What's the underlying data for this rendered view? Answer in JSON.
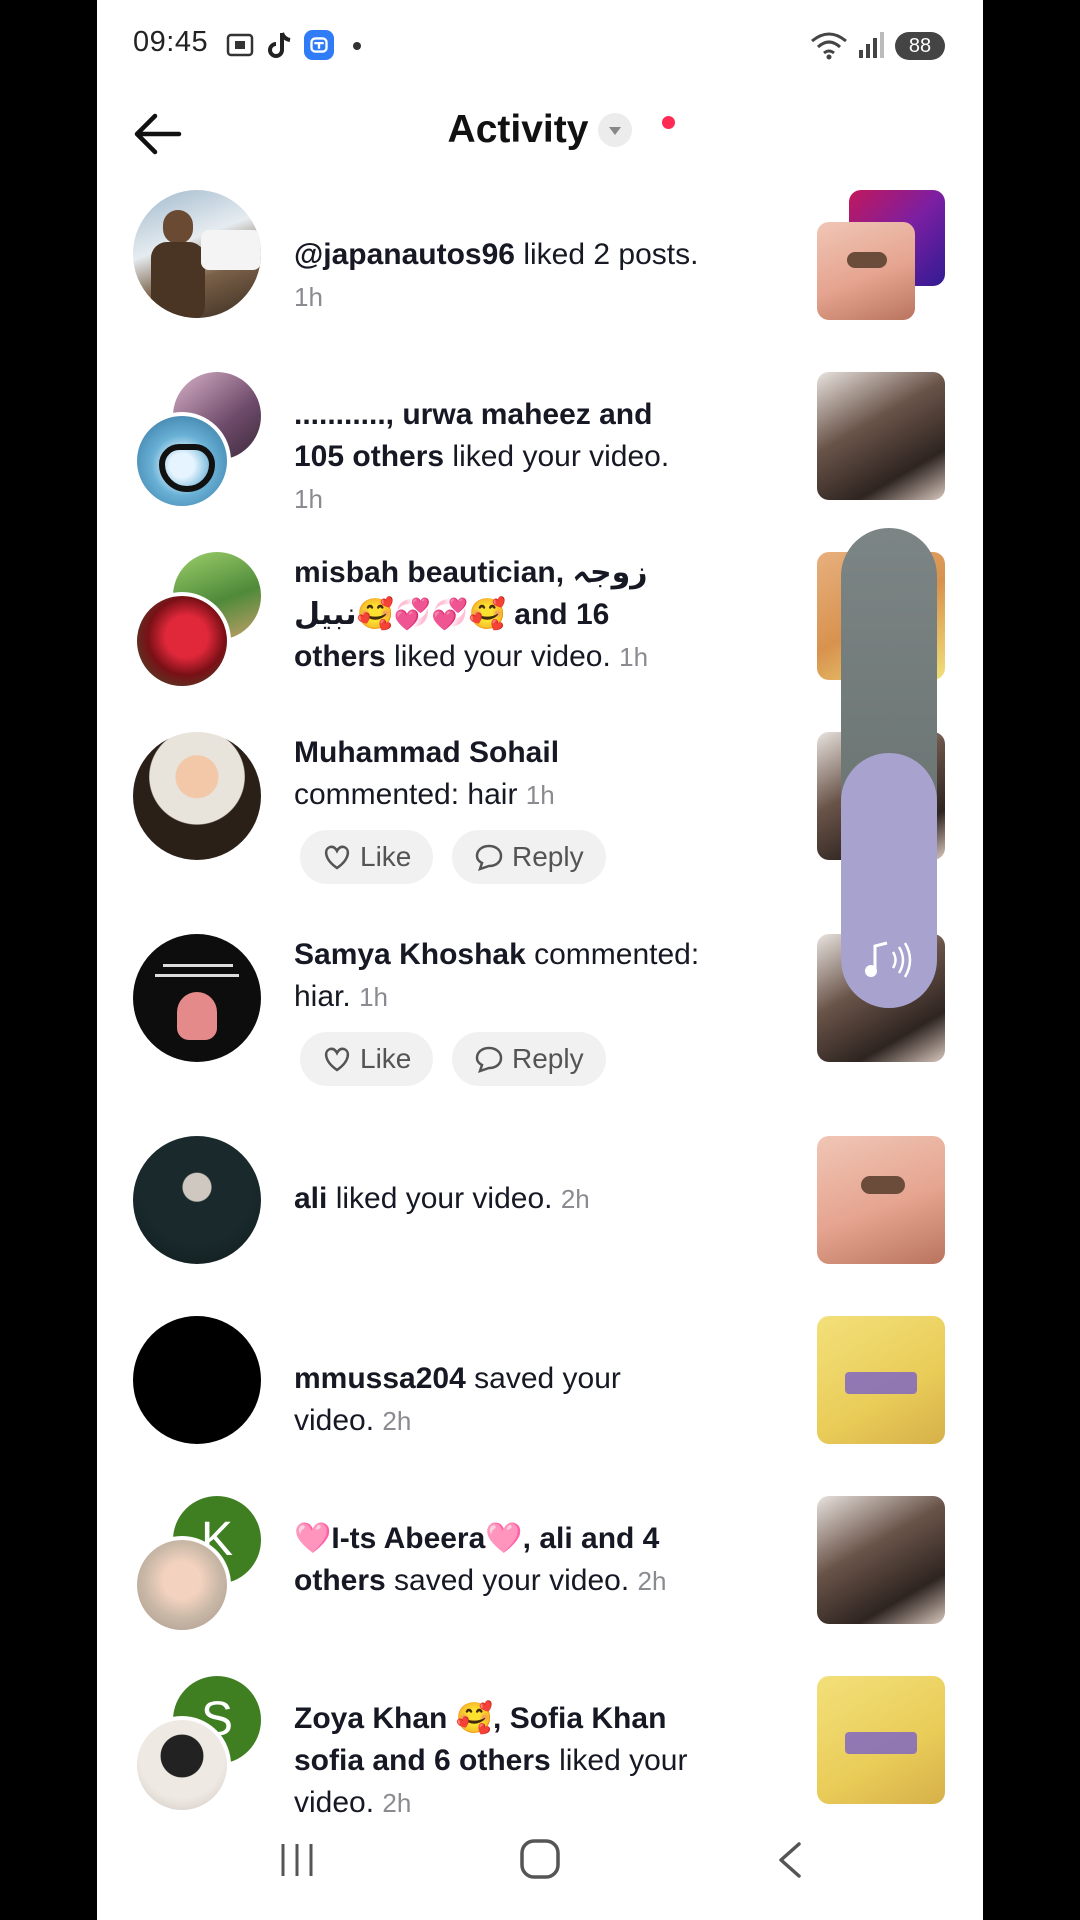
{
  "status_bar": {
    "time": "09:45",
    "battery": "88"
  },
  "header": {
    "title": "Activity"
  },
  "notifications": [
    {
      "name": "@japanautos96",
      "action": " liked 2 posts.",
      "time": "1h"
    },
    {
      "name": "..........., urwa maheez and 105 others",
      "action": " liked your video.",
      "time": "1h"
    },
    {
      "name": "misbah beautician, زوجہ نبیل🥰💞💞🥰 and 16 others",
      "action": " liked your video.",
      "time": "1h"
    },
    {
      "name": "Muhammad Sohail",
      "action": " commented: hair",
      "time": "1h",
      "like": "Like",
      "reply": "Reply"
    },
    {
      "name": "Samya Khoshak",
      "action": " commented: hiar.",
      "time": "1h",
      "like": "Like",
      "reply": "Reply"
    },
    {
      "name": "ali",
      "action": " liked your video.",
      "time": "2h"
    },
    {
      "name": "mmussa204",
      "action": " saved your video.",
      "time": "2h"
    },
    {
      "name": "🩷I-ts Abeera🩷, ali and 4 others",
      "action": " saved your video.",
      "time": "2h",
      "avatar_letter": "K"
    },
    {
      "name": "Zoya Khan 🥰, Sofia Khan sofia and 6 others",
      "action": " liked your video.",
      "time": "2h",
      "avatar_letter": "S"
    }
  ],
  "side_panel": {
    "more_label": "•••"
  },
  "colors": {
    "accent": "#fe2c55",
    "text": "#161823",
    "muted": "#8a8b91"
  }
}
